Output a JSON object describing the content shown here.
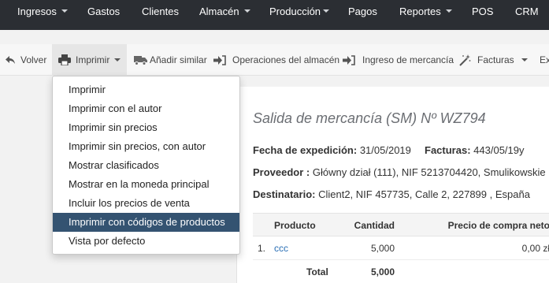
{
  "topnav": {
    "items": [
      {
        "label": "Ingresos",
        "caret": true
      },
      {
        "label": "Gastos",
        "caret": false
      },
      {
        "label": "Clientes",
        "caret": false
      },
      {
        "label": "Almacén",
        "caret": true
      },
      {
        "label": "Producción",
        "caret": true
      },
      {
        "label": "Pagos",
        "caret": false
      },
      {
        "label": "Reportes",
        "caret": true
      },
      {
        "label": "POS",
        "caret": false
      },
      {
        "label": "CRM",
        "caret": false
      }
    ]
  },
  "toolbar": {
    "back": "Volver",
    "print": "Imprimir",
    "add_similar": "Añadir similar",
    "warehouse_ops": "Operaciones del almacén",
    "goods_in": "Ingreso de mercancía",
    "invoices": "Facturas",
    "more": "Ex"
  },
  "print_menu": {
    "items": [
      "Imprimir",
      "Imprimir con el autor",
      "Imprimir sin precios",
      "Imprimir sin precios, con autor",
      "Mostrar clasificados",
      "Mostrar en la moneda principal",
      "Incluir los precios de venta",
      "Imprimir con códigos de productos",
      "Vista por defecto"
    ],
    "highlighted_index": 7
  },
  "document": {
    "title": "Salida de mercancía (SM) Nº WZ794",
    "issue_date_label": "Fecha de expedición:",
    "issue_date": "31/05/2019",
    "invoices_label": "Facturas:",
    "invoices_value": "443/05/19y",
    "supplier_label": "Proveedor :",
    "supplier_value": "Główny dział (111), NIF 5213704420, Smulikowskie",
    "recipient_label": "Destinatario:",
    "recipient_value": "Client2, NIF 457735, Calle 2, 227899 , España"
  },
  "table": {
    "headers": {
      "product": "Producto",
      "quantity": "Cantidad",
      "price": "Precio de compra neto"
    },
    "rows": [
      {
        "num": "1.",
        "product": "ccc",
        "quantity": "5,000",
        "price": "0,00 zł"
      }
    ],
    "total_label": "Total",
    "total_quantity": "5,000"
  }
}
